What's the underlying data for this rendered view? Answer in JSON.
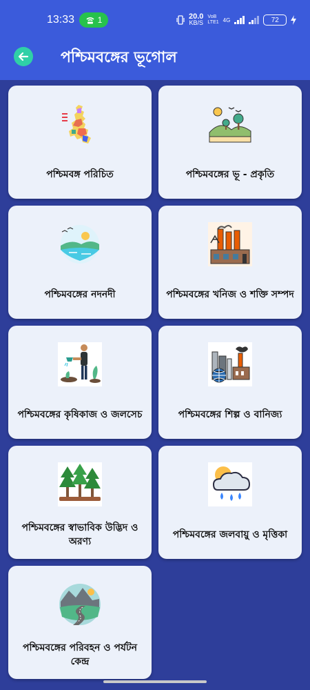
{
  "status_bar": {
    "time": "13:33",
    "hotspot_count": "1",
    "speed_value": "20.0",
    "speed_unit": "KB/S",
    "network_labels": [
      "VoB",
      "LTE1"
    ],
    "network_type": "4G",
    "battery": "72"
  },
  "app_bar": {
    "title": "পশ্চিমবঙ্গের ভূগোল",
    "background_color": "#3b5bdb",
    "back_icon_color": "#2fd0a7"
  },
  "cards": [
    {
      "label": "পশ্চিমবঙ্গ পরিচিত",
      "icon": "map-icon"
    },
    {
      "label": "পশ্চিমবঙ্গের ভূ - প্রকৃতি",
      "icon": "landscape-icon"
    },
    {
      "label": "পশ্চিমবঙ্গের নদনদী",
      "icon": "river-icon"
    },
    {
      "label": "পশ্চিমবঙ্গের খনিজ ও শক্তি সম্পদ",
      "icon": "factory-icon"
    },
    {
      "label": "পশ্চিমবঙ্গের কৃষিকাজ ও জলসেচ",
      "icon": "farmer-icon"
    },
    {
      "label": "পশ্চিমবঙ্গের শিল্প ও বানিজ্য",
      "icon": "industry-icon"
    },
    {
      "label": "পশ্চিমবঙ্গের স্বাভাবিক উদ্ভিদ ও অরণ্য",
      "icon": "forest-icon"
    },
    {
      "label": "পশ্চিমবঙ্গের জলবায়ু ও মৃত্তিকা",
      "icon": "weather-icon"
    },
    {
      "label": "পশ্চিমবঙ্গের পরিবহন ও পর্যটন কেন্দ্র",
      "icon": "road-icon"
    }
  ]
}
